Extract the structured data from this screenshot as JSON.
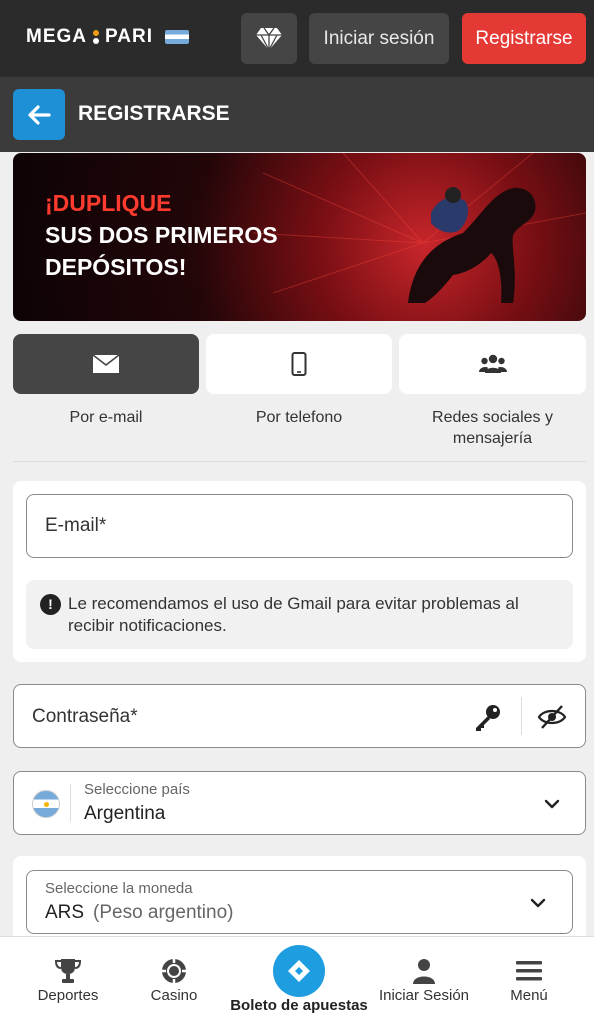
{
  "header": {
    "logo_text_left": "MEGA",
    "logo_text_right": "PARI",
    "login_label": "Iniciar sesión",
    "register_label": "Registrarse",
    "diamond_icon": "diamond-icon"
  },
  "titlebar": {
    "title": "REGISTRARSE",
    "back_icon": "arrow-left-icon"
  },
  "banner": {
    "line1": "¡DUPLIQUE",
    "line2": "SUS DOS PRIMEROS",
    "line3": "DEPÓSITOS!"
  },
  "methods": [
    {
      "label": "Por e-mail",
      "icon": "envelope-icon",
      "active": true
    },
    {
      "label": "Por telefono",
      "icon": "smartphone-icon",
      "active": false
    },
    {
      "label": "Redes sociales y mensajería",
      "icon": "users-icon",
      "active": false
    }
  ],
  "form": {
    "email_placeholder": "E-mail*",
    "gmail_notice": "Le recomendamos el uso de Gmail para evitar problemas al recibir notificaciones.",
    "password_placeholder": "Contraseña*",
    "country_caption": "Seleccione país",
    "country_value": "Argentina",
    "currency_caption": "Seleccione la moneda",
    "currency_code": "ARS",
    "currency_name": "(Peso argentino)"
  },
  "bottom_nav": {
    "items": [
      {
        "label": "Deportes",
        "icon": "trophy-icon"
      },
      {
        "label": "Casino",
        "icon": "casino-chip-icon"
      },
      {
        "label": "Boleto de apuestas",
        "icon": "ticket-icon"
      },
      {
        "label": "Iniciar Sesión",
        "icon": "user-icon"
      },
      {
        "label": "Menú",
        "icon": "menu-icon"
      }
    ]
  },
  "colors": {
    "accent_blue": "#1e90d6",
    "register_red": "#e53935",
    "header_bg": "#2b2b2b"
  }
}
